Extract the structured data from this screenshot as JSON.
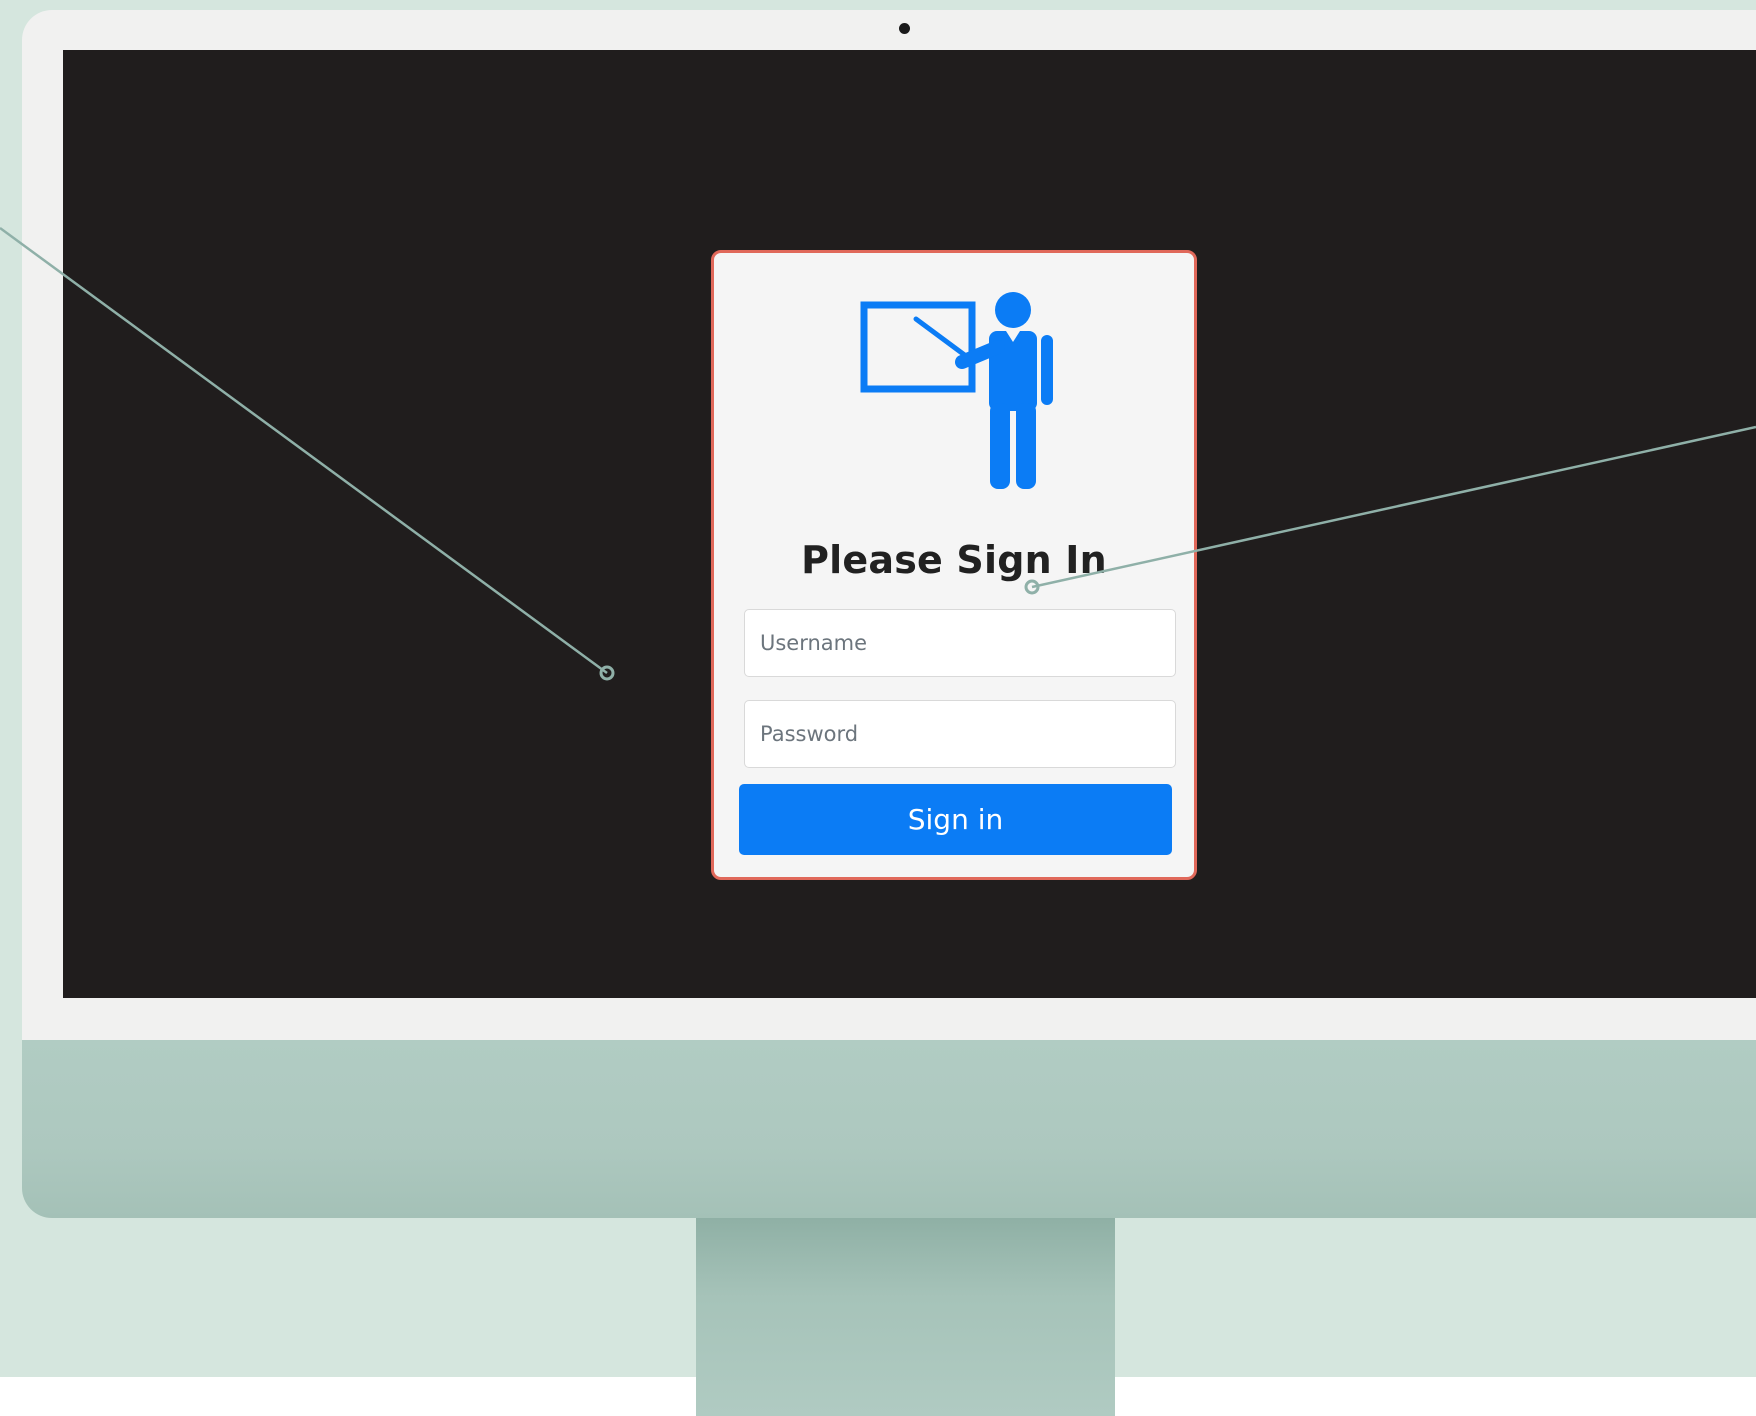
{
  "login": {
    "title": "Please Sign In",
    "username_placeholder": "Username",
    "password_placeholder": "Password",
    "submit_label": "Sign in"
  },
  "icons": {
    "logo": "teacher-presentation-icon"
  },
  "colors": {
    "accent": "#0b7cf5",
    "card_border": "#e0685a",
    "card_bg": "#f5f5f5",
    "screen_bg": "#201d1d",
    "monitor_body": "#b1ccc3",
    "backdrop": "#d5e6de",
    "callout_line": "#8fb0a8"
  }
}
